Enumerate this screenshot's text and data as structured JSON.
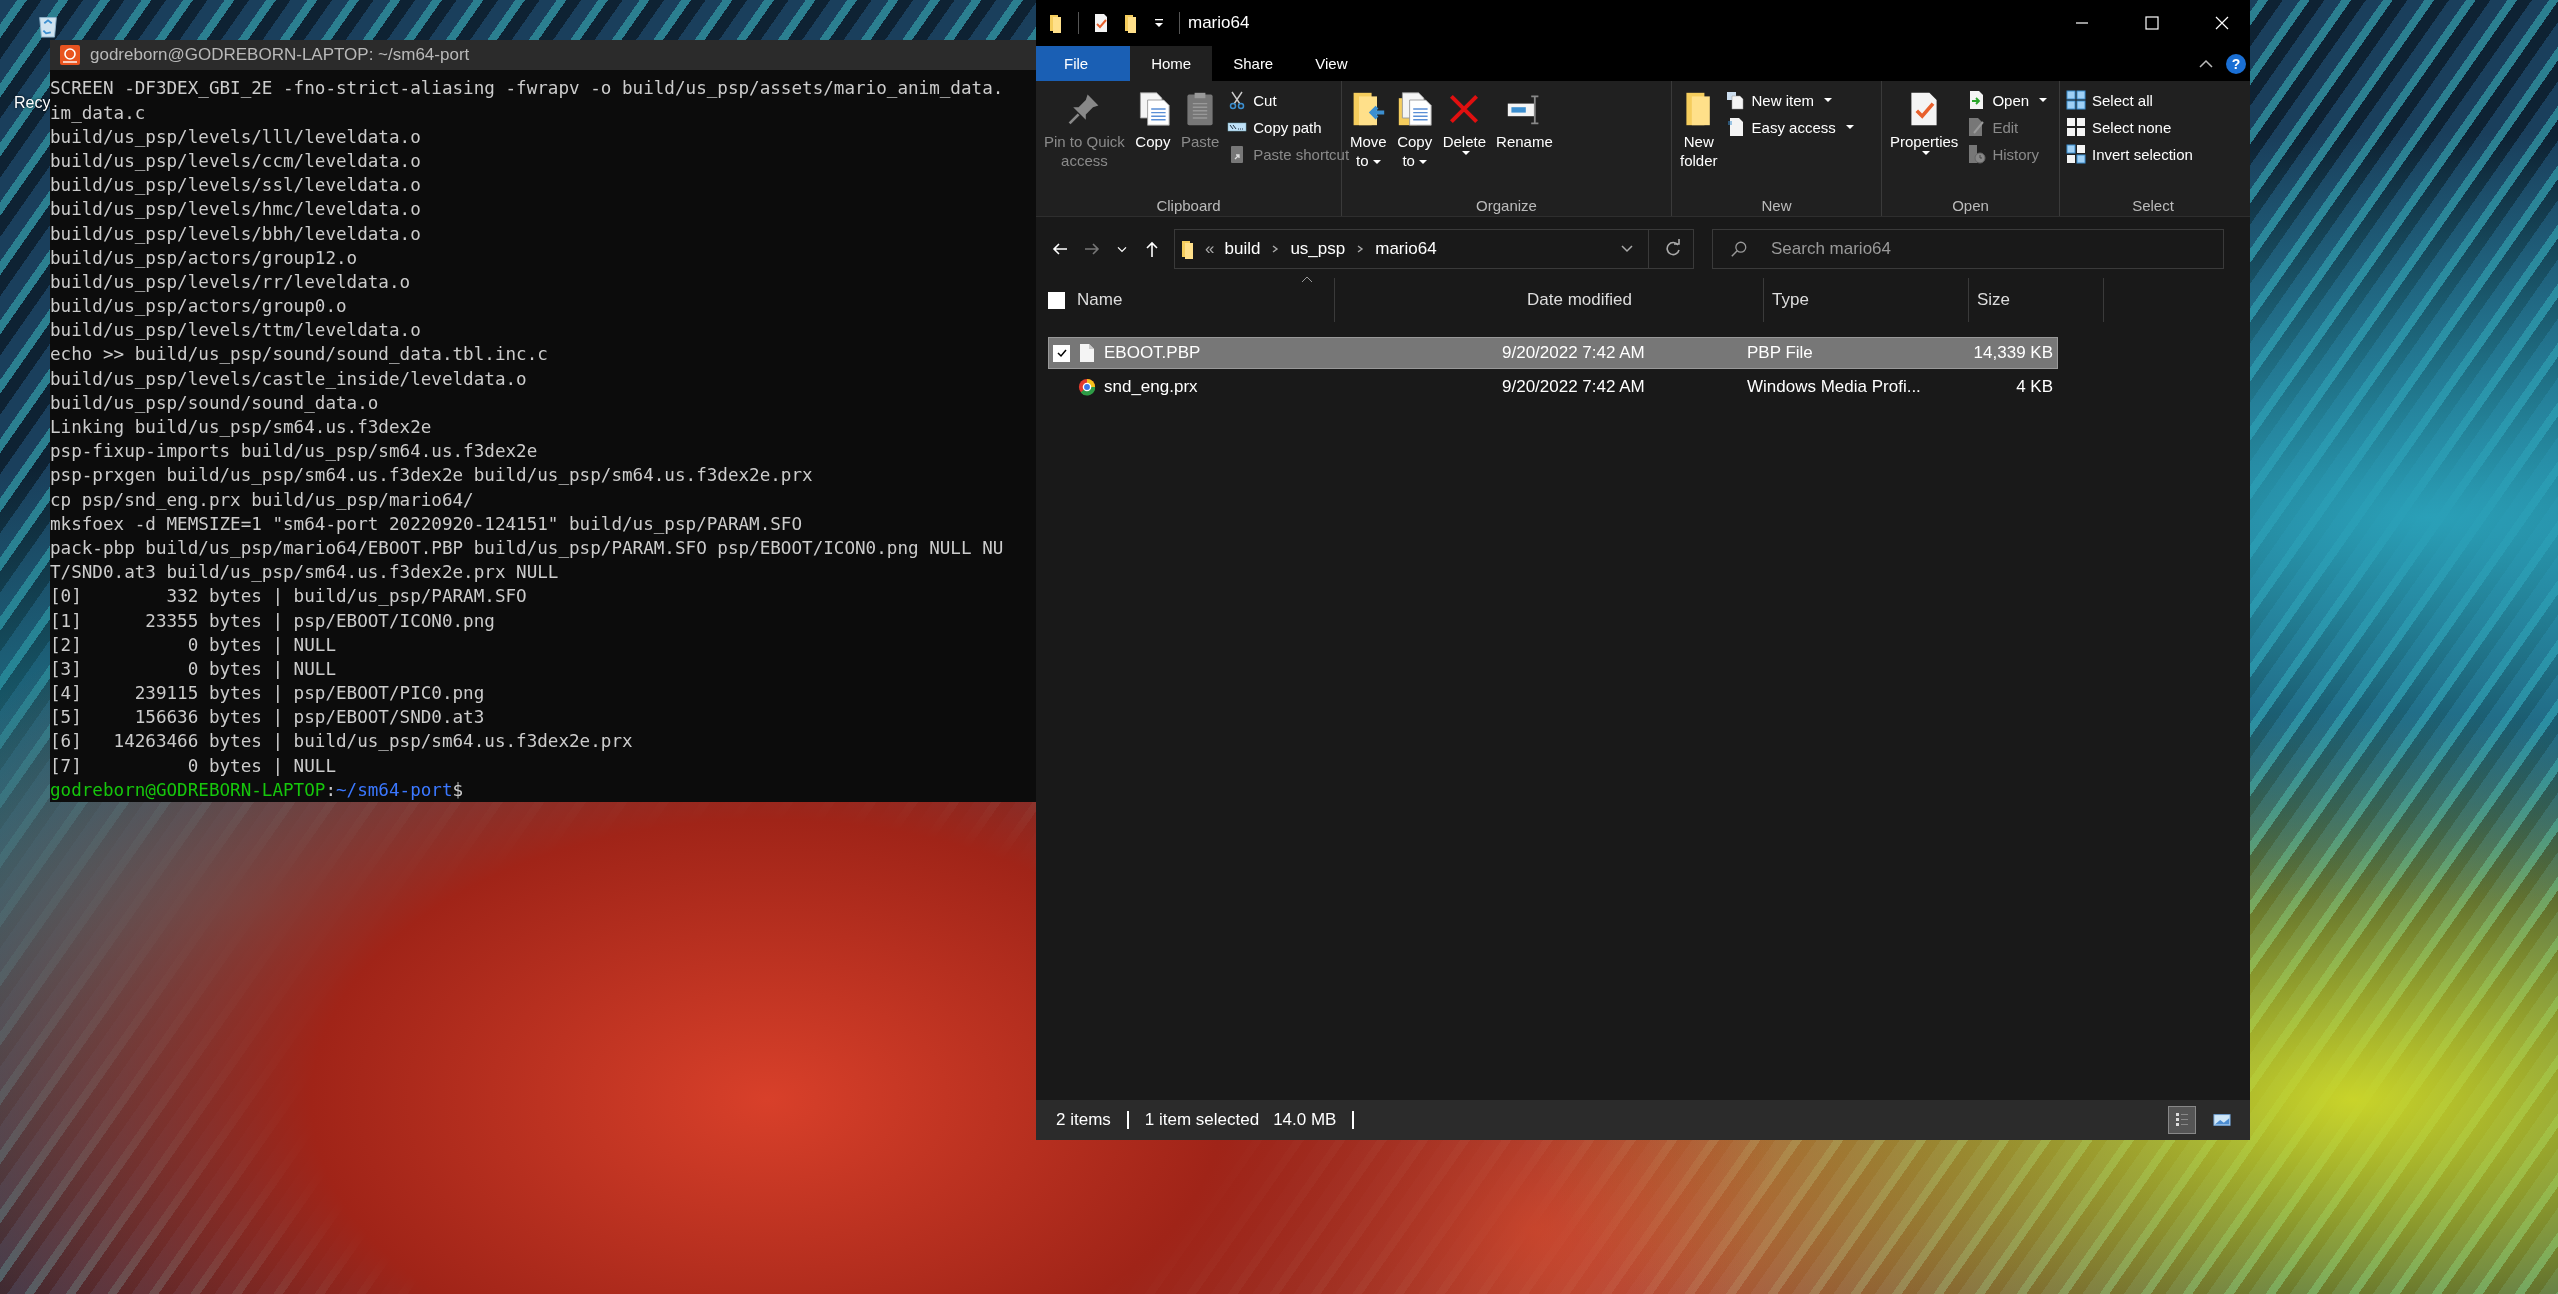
{
  "desktop": {
    "icons": [
      {
        "label": "Recy"
      }
    ]
  },
  "terminal": {
    "title": "godreborn@GODREBORN-LAPTOP: ~/sm64-port",
    "lines": [
      "SCREEN -DF3DEX_GBI_2E -fno-strict-aliasing -fwrapv -o build/us_psp/assets/mario_anim_data.",
      "im_data.c",
      "build/us_psp/levels/lll/leveldata.o",
      "build/us_psp/levels/ccm/leveldata.o",
      "build/us_psp/levels/ssl/leveldata.o",
      "build/us_psp/levels/hmc/leveldata.o",
      "build/us_psp/levels/bbh/leveldata.o",
      "build/us_psp/actors/group12.o",
      "build/us_psp/levels/rr/leveldata.o",
      "build/us_psp/actors/group0.o",
      "build/us_psp/levels/ttm/leveldata.o",
      "echo >> build/us_psp/sound/sound_data.tbl.inc.c",
      "build/us_psp/levels/castle_inside/leveldata.o",
      "build/us_psp/sound/sound_data.o",
      "Linking build/us_psp/sm64.us.f3dex2e",
      "psp-fixup-imports build/us_psp/sm64.us.f3dex2e",
      "psp-prxgen build/us_psp/sm64.us.f3dex2e build/us_psp/sm64.us.f3dex2e.prx",
      "cp psp/snd_eng.prx build/us_psp/mario64/",
      "mksfoex -d MEMSIZE=1 \"sm64-port 20220920-124151\" build/us_psp/PARAM.SFO",
      "pack-pbp build/us_psp/mario64/EBOOT.PBP build/us_psp/PARAM.SFO psp/EBOOT/ICON0.png NULL NU",
      "T/SND0.at3 build/us_psp/sm64.us.f3dex2e.prx NULL",
      "[0]        332 bytes | build/us_psp/PARAM.SFO",
      "[1]      23355 bytes | psp/EBOOT/ICON0.png",
      "[2]          0 bytes | NULL",
      "[3]          0 bytes | NULL",
      "[4]     239115 bytes | psp/EBOOT/PIC0.png",
      "[5]     156636 bytes | psp/EBOOT/SND0.at3",
      "[6]   14263466 bytes | build/us_psp/sm64.us.f3dex2e.prx",
      "[7]          0 bytes | NULL"
    ],
    "prompt": {
      "user": "godreborn@GODREBORN-LAPTOP",
      "separator": ":",
      "path": "~/sm64-port",
      "symbol": "$"
    }
  },
  "explorer": {
    "title": "mario64",
    "help": "?",
    "tabs": [
      {
        "label": "File",
        "kind": "file",
        "selected": false
      },
      {
        "label": "Home",
        "kind": "tab",
        "selected": true
      },
      {
        "label": "Share",
        "kind": "tab",
        "selected": false
      },
      {
        "label": "View",
        "kind": "tab",
        "selected": false
      }
    ],
    "ribbon": [
      {
        "label": "Clipboard",
        "large": [
          {
            "lines": [
              "Pin to Quick",
              "access"
            ],
            "disabled": true,
            "dropdown": false
          },
          {
            "lines": [
              "Copy"
            ],
            "disabled": false,
            "dropdown": false
          },
          {
            "lines": [
              "Paste"
            ],
            "disabled": true,
            "dropdown": false
          }
        ],
        "small": [
          {
            "label": "Cut",
            "disabled": false,
            "dropdown": false
          },
          {
            "label": "Copy path",
            "disabled": false,
            "dropdown": false
          },
          {
            "label": "Paste shortcut",
            "disabled": true,
            "dropdown": false
          }
        ]
      },
      {
        "label": "Organize",
        "large": [
          {
            "lines": [
              "Move",
              "to"
            ],
            "disabled": false,
            "dropdown": true
          },
          {
            "lines": [
              "Copy",
              "to"
            ],
            "disabled": false,
            "dropdown": true
          },
          {
            "lines": [
              "Delete"
            ],
            "disabled": false,
            "dropdown": true
          },
          {
            "lines": [
              "Rename"
            ],
            "disabled": false,
            "dropdown": false
          }
        ]
      },
      {
        "label": "New",
        "large": [
          {
            "lines": [
              "New",
              "folder"
            ],
            "disabled": false,
            "dropdown": false
          }
        ],
        "small": [
          {
            "label": "New item",
            "disabled": false,
            "dropdown": true
          },
          {
            "label": "Easy access",
            "disabled": false,
            "dropdown": true
          }
        ]
      },
      {
        "label": "Open",
        "large": [
          {
            "lines": [
              "Properties"
            ],
            "disabled": false,
            "dropdown": true
          }
        ],
        "small": [
          {
            "label": "Open",
            "disabled": false,
            "dropdown": true
          },
          {
            "label": "Edit",
            "disabled": true,
            "dropdown": false
          },
          {
            "label": "History",
            "disabled": true,
            "dropdown": false
          }
        ]
      },
      {
        "label": "Select",
        "small": [
          {
            "label": "Select all",
            "disabled": false,
            "dropdown": false
          },
          {
            "label": "Select none",
            "disabled": false,
            "dropdown": false
          },
          {
            "label": "Invert selection",
            "disabled": false,
            "dropdown": false
          }
        ]
      }
    ],
    "nav": {
      "back_disabled": false,
      "forward_disabled": true
    },
    "address": {
      "overflow": "«",
      "crumbs": [
        "build",
        "us_psp",
        "mario64"
      ]
    },
    "search": {
      "placeholder": "Search mario64"
    },
    "columns": [
      "Name",
      "Date modified",
      "Type",
      "Size"
    ],
    "select_all_checked": false,
    "rows": [
      {
        "name": "EBOOT.PBP",
        "date": "9/20/2022 7:42 AM",
        "type": "PBP File",
        "size": "14,339 KB",
        "kind": "file",
        "selected": true,
        "checked": true
      },
      {
        "name": "snd_eng.prx",
        "date": "9/20/2022 7:42 AM",
        "type": "Windows Media Profi...",
        "size": "4 KB",
        "kind": "media",
        "selected": false,
        "checked": false
      }
    ],
    "status": {
      "count": "2 items",
      "selection": "1 item selected",
      "size": "14.0 MB",
      "views": [
        {
          "selected": true
        },
        {
          "selected": false
        }
      ]
    }
  }
}
